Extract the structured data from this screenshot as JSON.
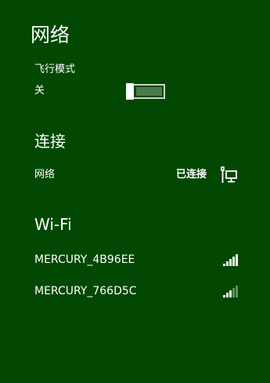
{
  "panel": {
    "title": "网络"
  },
  "airplane_mode": {
    "label": "飞行模式",
    "state_text": "关",
    "enabled": false
  },
  "connections": {
    "heading": "连接",
    "network_label": "网络",
    "status": "已连接",
    "icon": "wired-network-icon"
  },
  "wifi": {
    "heading": "Wi-Fi",
    "networks": [
      {
        "ssid": "MERCURY_4B96EE",
        "signal_bars": 5,
        "max_bars": 5
      },
      {
        "ssid": "MERCURY_766D5C",
        "signal_bars": 3,
        "max_bars": 5
      }
    ]
  },
  "colors": {
    "background": "#024802",
    "text": "#ffffff",
    "toggle_fill": "#4b7a4b",
    "signal_dim": "#5f8f5f"
  }
}
